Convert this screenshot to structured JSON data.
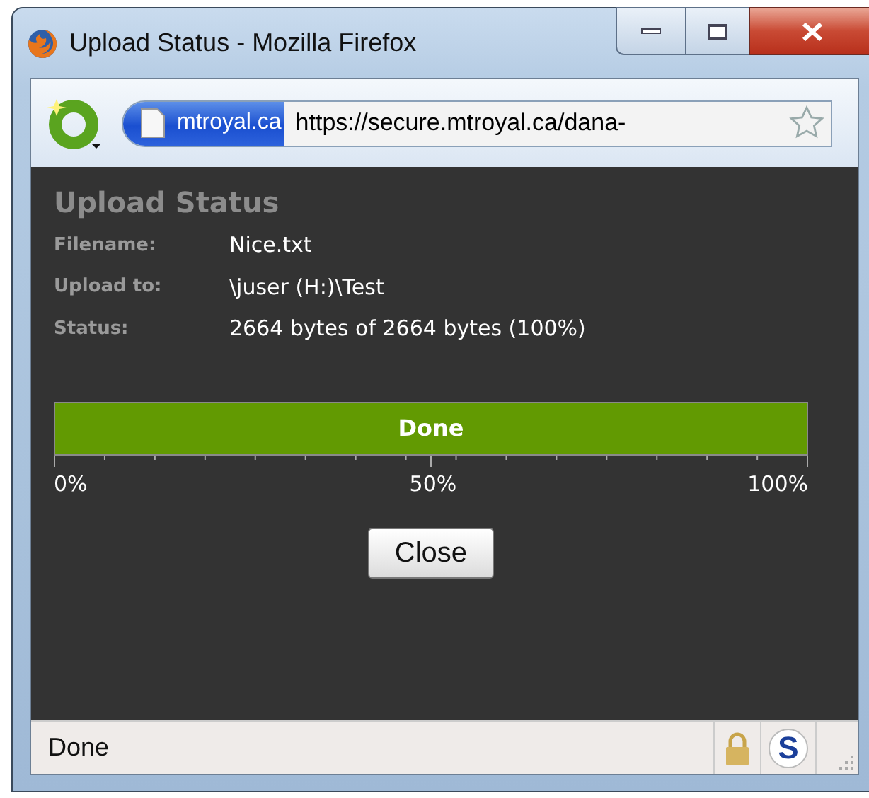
{
  "window": {
    "title": "Upload Status - Mozilla Firefox"
  },
  "address_bar": {
    "site_identity": "mtroyal.ca",
    "url": "https://secure.mtroyal.ca/dana-"
  },
  "dialog": {
    "heading": "Upload Status",
    "fields": [
      {
        "label": "Filename:",
        "value": "Nice.txt"
      },
      {
        "label": "Upload to:",
        "value": "\\juser (H:)\\Test"
      },
      {
        "label": "Status:",
        "value": "2664 bytes of 2664 bytes (100%)"
      }
    ],
    "progress": {
      "label": "Done",
      "level": 1,
      "scale_labels": [
        "0%",
        "50%",
        "100%"
      ]
    },
    "close_button": "Close"
  },
  "status_bar": {
    "text": "Done",
    "addon_icon": "S"
  }
}
